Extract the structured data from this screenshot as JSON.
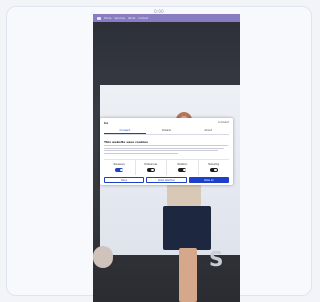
{
  "top_label": "0:00",
  "navbar": {
    "items": [
      "Home",
      "Services",
      "About",
      "Contact"
    ]
  },
  "scene": {
    "screen_logo": "",
    "overlay_text": "S"
  },
  "cookie_dialog": {
    "logo": "Co",
    "powered_by": "Cookiebot",
    "tabs": [
      "Consent",
      "Details",
      "About"
    ],
    "title": "This website uses cookies",
    "toggles": [
      {
        "label": "Necessary",
        "state": "on"
      },
      {
        "label": "Preferences",
        "state": "off"
      },
      {
        "label": "Statistics",
        "state": "off"
      },
      {
        "label": "Marketing",
        "state": "off"
      }
    ],
    "buttons": {
      "deny": "Deny",
      "allow_selection": "Allow selection",
      "allow_all": "Allow all"
    }
  }
}
